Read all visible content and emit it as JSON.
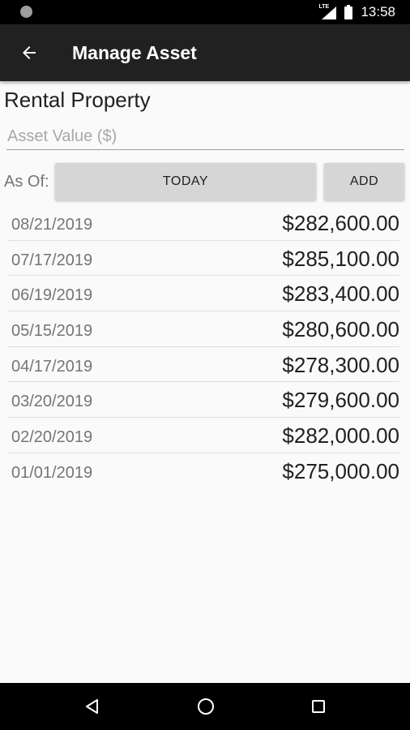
{
  "status_bar": {
    "network_label": "LTE",
    "time": "13:58"
  },
  "app_bar": {
    "title": "Manage Asset",
    "back_icon": "arrow-back-icon"
  },
  "asset": {
    "name": "Rental Property",
    "value_placeholder": "Asset Value ($)",
    "value": ""
  },
  "as_of": {
    "label": "As Of:",
    "today_label": "TODAY",
    "add_label": "ADD"
  },
  "history": [
    {
      "date": "08/21/2019",
      "value": "$282,600.00"
    },
    {
      "date": "07/17/2019",
      "value": "$285,100.00"
    },
    {
      "date": "06/19/2019",
      "value": "$283,400.00"
    },
    {
      "date": "05/15/2019",
      "value": "$280,600.00"
    },
    {
      "date": "04/17/2019",
      "value": "$278,300.00"
    },
    {
      "date": "03/20/2019",
      "value": "$279,600.00"
    },
    {
      "date": "02/20/2019",
      "value": "$282,000.00"
    },
    {
      "date": "01/01/2019",
      "value": "$275,000.00"
    }
  ],
  "nav_bar": {
    "back_icon": "triangle-back-icon",
    "home_icon": "circle-home-icon",
    "recents_icon": "square-recents-icon"
  },
  "colors": {
    "app_bar": "#212121",
    "background": "#fafafa",
    "button": "#d6d6d6"
  }
}
